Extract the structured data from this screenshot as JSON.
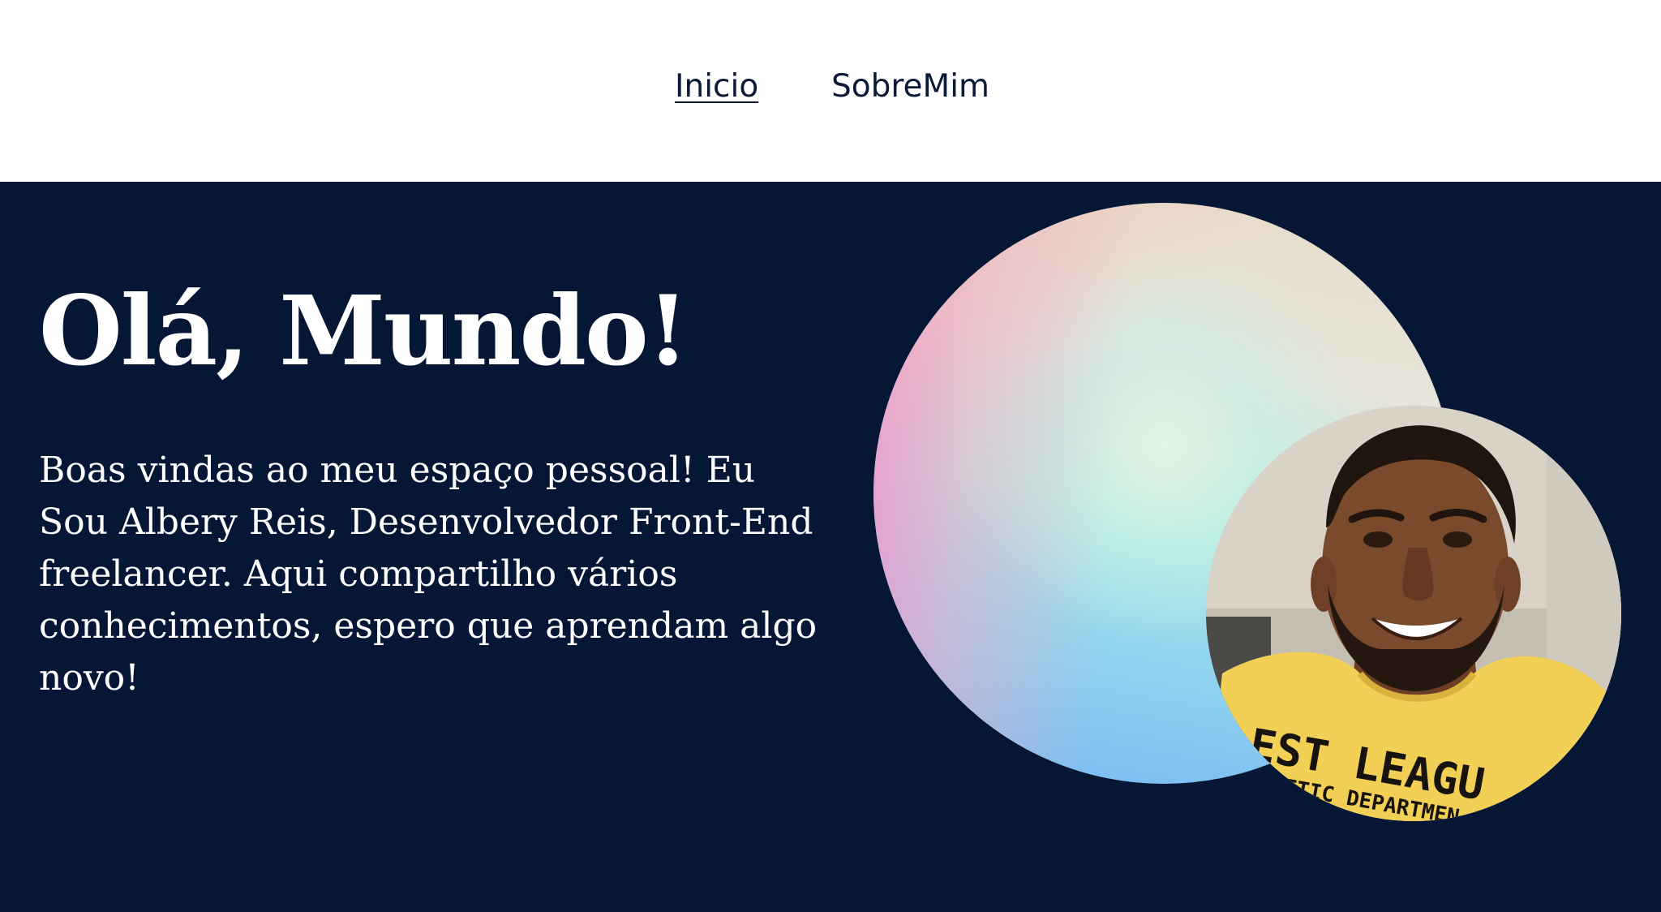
{
  "nav": {
    "items": [
      {
        "label": "Inicio",
        "active": true
      },
      {
        "label": "SobreMim",
        "active": false
      }
    ]
  },
  "hero": {
    "title": "Olá, Mundo!",
    "text": "Boas vindas ao meu espaço pessoal! Eu Sou Albery Reis, Desenvolvedor Front-End freelancer. Aqui compartilho vários conhecimentos, espero que aprendam algo novo!",
    "avatar_alt": "profile-photo",
    "shirt_text_line1": "EST LEAGU",
    "shirt_text_line2": "ETIC DEPARTMEN"
  },
  "colors": {
    "background": "#051735",
    "header": "#ffffff",
    "nav_text": "#0b1a36",
    "hero_text": "#ffffff"
  }
}
